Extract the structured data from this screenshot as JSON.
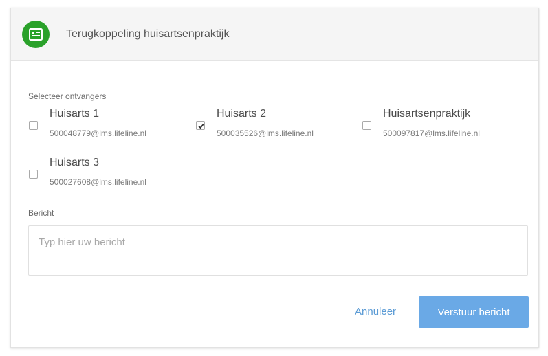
{
  "header": {
    "title": "Terugkoppeling huisartsenpraktijk",
    "icon": "message-card-icon",
    "accent_color": "#2aa12a"
  },
  "recipients_section": {
    "label": "Selecteer ontvangers",
    "items": [
      {
        "name": "Huisarts 1",
        "email": "500048779@lms.lifeline.nl",
        "checked": false
      },
      {
        "name": "Huisarts 2",
        "email": "500035526@lms.lifeline.nl",
        "checked": true
      },
      {
        "name": "Huisartsenpraktijk",
        "email": "500097817@lms.lifeline.nl",
        "checked": false
      },
      {
        "name": "Huisarts 3",
        "email": "500027608@lms.lifeline.nl",
        "checked": false
      }
    ]
  },
  "message_section": {
    "label": "Bericht",
    "placeholder": "Typ hier uw bericht",
    "value": ""
  },
  "actions": {
    "cancel_label": "Annuleer",
    "send_label": "Verstuur bericht",
    "send_color": "#6aa9e6",
    "link_color": "#5b9bd5"
  }
}
